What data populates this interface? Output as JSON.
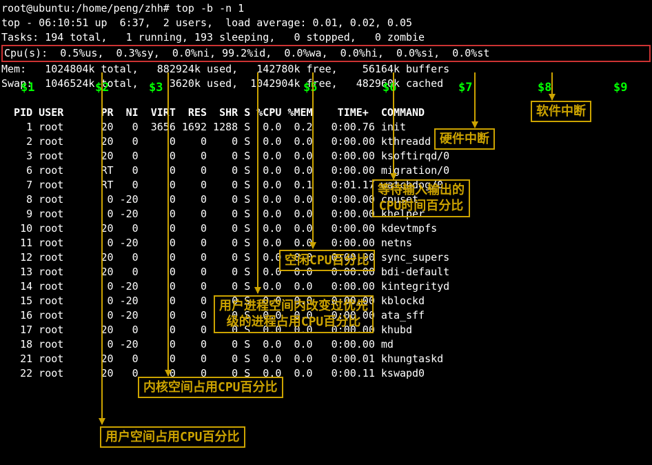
{
  "prompt": "root@ubuntu:/home/peng/zhh# top -b -n 1",
  "summary": {
    "line1": "top - 06:10:51 up  6:37,  2 users,  load average: 0.01, 0.02, 0.05",
    "line2": "Tasks: 194 total,   1 running, 193 sleeping,   0 stopped,   0 zombie",
    "cpu": "Cpu(s):  0.5%us,  0.3%sy,  0.0%ni, 99.2%id,  0.0%wa,  0.0%hi,  0.0%si,  0.0%st",
    "mem": "Mem:   1024804k total,   882924k used,   142780k free,    56164k buffers",
    "swap": "Swap:  1046524k total,     3620k used,  1042904k free,   482960k cached"
  },
  "columns": "  PID USER      PR  NI  VIRT  RES  SHR S %CPU %MEM    TIME+  COMMAND",
  "procs": [
    "    1 root      20   0  3656 1692 1288 S  0.0  0.2   0:00.76 init",
    "    2 root      20   0     0    0    0 S  0.0  0.0   0:00.00 kthreadd",
    "    3 root      20   0     0    0    0 S  0.0  0.0   0:00.00 ksoftirqd/0",
    "    6 root      RT   0     0    0    0 S  0.0  0.0   0:00.00 migration/0",
    "    7 root      RT   0     0    0    0 S  0.0  0.1   0:01.17 watchdog/0",
    "    8 root       0 -20     0    0    0 S  0.0  0.0   0:00.00 cpuset",
    "    9 root       0 -20     0    0    0 S  0.0  0.0   0:00.00 khelper",
    "   10 root      20   0     0    0    0 S  0.0  0.0   0:00.00 kdevtmpfs",
    "   11 root       0 -20     0    0    0 S  0.0  0.0   0:00.00 netns",
    "   12 root      20   0     0    0    0 S  0.0  0.0   0:00.00 sync_supers",
    "   13 root      20   0     0    0    0 S  0.0  0.0   0:00.00 bdi-default",
    "   14 root       0 -20     0    0    0 S  0.0  0.0   0:00.00 kintegrityd",
    "   15 root       0 -20     0    0    0 S  0.0  0.0   0:00.00 kblockd",
    "   16 root       0 -20     0    0    0 S  0.0  0.0   0:00.00 ata_sff",
    "   17 root      20   0     0    0    0 S  0.0  0.0   0:00.00 khubd",
    "   18 root       0 -20     0    0    0 S  0.0  0.0   0:00.00 md",
    "   21 root      20   0     0    0    0 S  0.0  0.0   0:00.01 khungtaskd",
    "   22 root      20   0     0    0    0 S  0.0  0.0   0:00.11 kswapd0"
  ],
  "markers": {
    "m1": "$1",
    "m2": "$2",
    "m3": "$3",
    "m5": "$5",
    "m6": "$6",
    "m7": "$7",
    "m8": "$8",
    "m9": "$9"
  },
  "annotations": {
    "soft_irq": "软件中断",
    "hard_irq": "硬件中断",
    "io_wait": "等待输入输出的\nCPU时间百分比",
    "idle": "空闲CPU百分比",
    "nice": "用户进程空间内改变过优先\n级的进程占用CPU百分比",
    "kernel": "内核空间占用CPU百分比",
    "user": "用户空间占用CPU百分比"
  }
}
